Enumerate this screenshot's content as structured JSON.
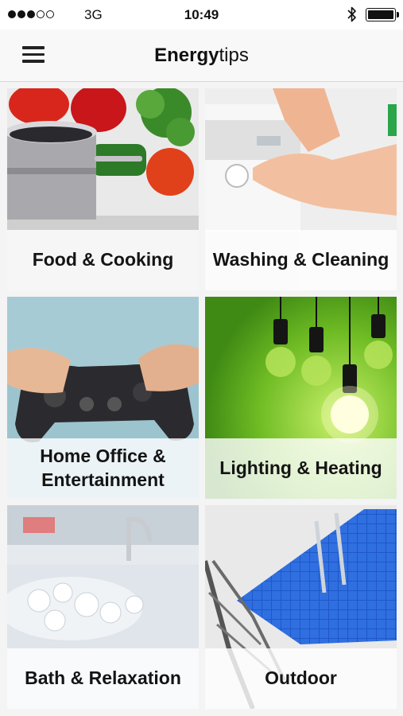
{
  "status_bar": {
    "carrier": "3G",
    "time": "10:49",
    "signal_filled": 3,
    "signal_total": 5
  },
  "header": {
    "title_bold": "Energy",
    "title_regular": "tips"
  },
  "tiles": [
    {
      "label": "Food & Cooking"
    },
    {
      "label": "Washing & Cleaning"
    },
    {
      "label": "Home Office & Entertainment"
    },
    {
      "label": "Lighting & Heating"
    },
    {
      "label": "Bath & Relaxation"
    },
    {
      "label": "Outdoor"
    }
  ],
  "icons": {
    "menu": "hamburger-menu-icon",
    "bluetooth": "bluetooth-icon",
    "battery": "battery-icon"
  }
}
